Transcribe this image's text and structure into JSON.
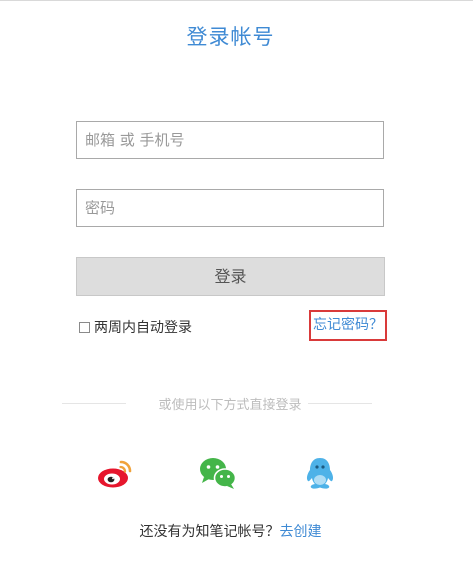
{
  "page": {
    "title": "登录帐号"
  },
  "form": {
    "account_placeholder": "邮箱 或 手机号",
    "password_placeholder": "密码",
    "login_label": "登录",
    "remember_label": "两周内自动登录",
    "forgot_label": "忘记密码？"
  },
  "alt_login": {
    "divider_text": "或使用以下方式直接登录",
    "providers": [
      {
        "icon": "weibo-icon",
        "color": "#e6162d"
      },
      {
        "icon": "wechat-icon",
        "color": "#44b549"
      },
      {
        "icon": "qq-icon",
        "color": "#4eb2e8"
      }
    ]
  },
  "signup": {
    "prompt": "还没有为知笔记帐号？",
    "link": "去创建"
  }
}
